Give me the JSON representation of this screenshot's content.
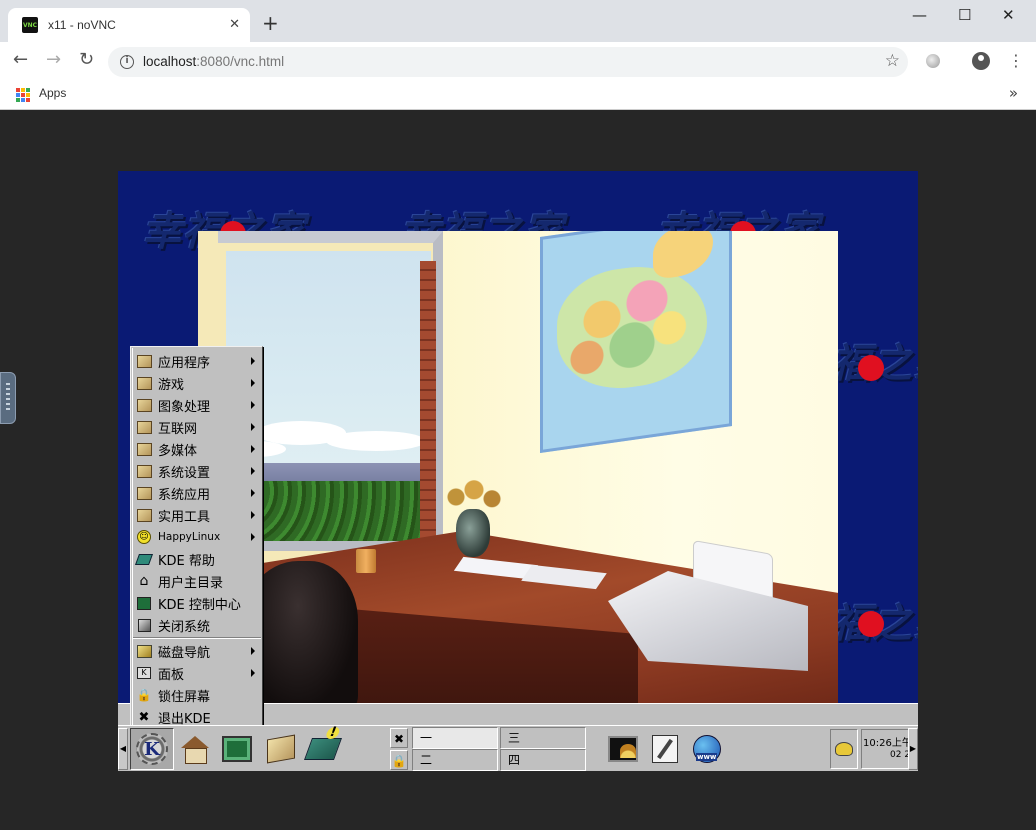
{
  "browser": {
    "tab_title": "x11 - noVNC",
    "favicon_text": "VNC",
    "url_host": "localhost",
    "url_rest": ":8080/vnc.html",
    "bookmarks_apps_label": "Apps",
    "apps_colors": [
      "#ea4335",
      "#fbbc05",
      "#34a853",
      "#4285f4",
      "#ea4335",
      "#fbbc05",
      "#34a853",
      "#4285f4",
      "#ea4335"
    ]
  },
  "desktop": {
    "watermark_text": "幸福之家",
    "wallpaper_color": "#0a1a74"
  },
  "kmenu": {
    "items": [
      {
        "label": "应用程序",
        "icon": "box-icon",
        "submenu": true
      },
      {
        "label": "游戏",
        "icon": "box-icon",
        "submenu": true
      },
      {
        "label": "图象处理",
        "icon": "box-icon",
        "submenu": true
      },
      {
        "label": "互联网",
        "icon": "box-icon",
        "submenu": true
      },
      {
        "label": "多媒体",
        "icon": "box-icon",
        "submenu": true
      },
      {
        "label": "系统设置",
        "icon": "box-icon",
        "submenu": true
      },
      {
        "label": "系统应用",
        "icon": "box-icon",
        "submenu": true
      },
      {
        "label": "实用工具",
        "icon": "box-icon",
        "submenu": true
      },
      {
        "label": "HappyLinux",
        "icon": "smiley-icon",
        "submenu": true
      },
      {
        "label": "KDE 帮助",
        "icon": "help-book-icon",
        "submenu": false
      },
      {
        "label": "用户主目录",
        "icon": "home-icon",
        "submenu": false
      },
      {
        "label": "KDE 控制中心",
        "icon": "control-center-icon",
        "submenu": false
      },
      {
        "label": "关闭系统",
        "icon": "shutdown-icon",
        "submenu": false
      },
      {
        "label": "磁盘导航",
        "icon": "disk-navigator-icon",
        "submenu": true
      },
      {
        "label": "面板",
        "icon": "panel-icon",
        "submenu": true
      },
      {
        "label": "锁住屏幕",
        "icon": "lock-icon",
        "submenu": false
      },
      {
        "label": "退出KDE",
        "icon": "logout-icon",
        "submenu": false
      }
    ]
  },
  "panel": {
    "desktops": [
      "一",
      "二",
      "三",
      "四"
    ],
    "active_desktop": "一",
    "clock_time": "10:26上午",
    "clock_date": "02 2"
  }
}
